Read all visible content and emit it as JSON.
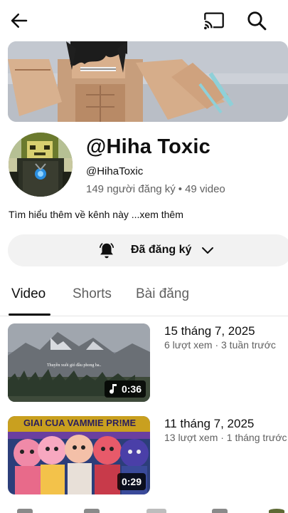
{
  "header": {
    "back_icon": "arrow-left-icon",
    "cast_icon": "cast-icon",
    "search_icon": "search-icon"
  },
  "channel": {
    "title": "@Hiha Toxic",
    "handle": "@HihaToxic",
    "subscribers": "149 người đăng ký",
    "separator": "•",
    "video_count": "49 video",
    "about": "Tìm hiểu thêm về kênh này ...",
    "about_more": "xem thêm"
  },
  "subscribe_button": {
    "label": "Đã đăng ký",
    "icon": "bell-icon"
  },
  "tabs": [
    {
      "label": "Video",
      "active": true
    },
    {
      "label": "Shorts",
      "active": false
    },
    {
      "label": "Bài đăng",
      "active": false
    }
  ],
  "videos": [
    {
      "title": "15 tháng 7, 2025",
      "meta": "6 lượt xem · 3 tuần trước",
      "duration": "0:36",
      "thumb_caption": "Thuyền xuôi gió đầu phong ba..",
      "has_music_icon": true
    },
    {
      "title": "11 tháng 7, 2025",
      "meta": "13 lượt xem · 1 tháng trước",
      "duration": "0:29",
      "thumb_caption": "GIAI CUA VAMMIE PR!ME",
      "has_music_icon": false
    }
  ]
}
